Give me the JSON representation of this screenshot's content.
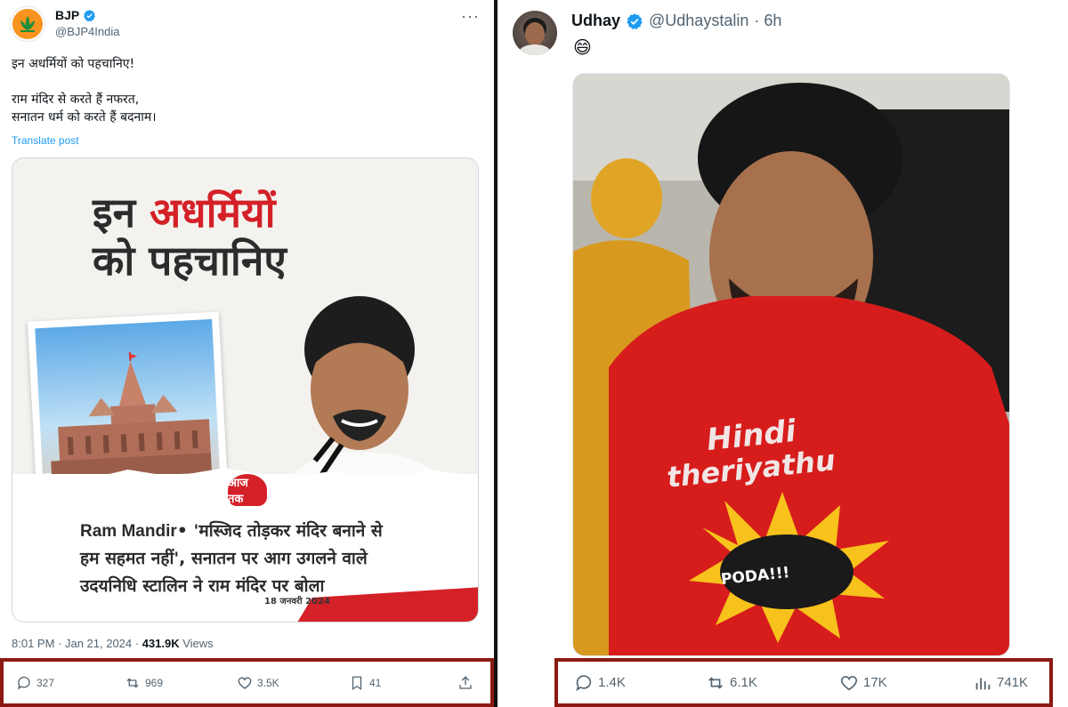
{
  "left_tweet": {
    "name": "BJP",
    "handle": "@BJP4India",
    "text_lines": [
      "इन अधर्मियों को पहचानिए!",
      "",
      "राम मंदिर से करते हैं नफरत,",
      "सनातन धर्म को करते हैं बदनाम।"
    ],
    "translate_label": "Translate post",
    "image": {
      "title_line1_a": "इन ",
      "title_line1_b": "अधर्मियों",
      "title_line2": "को पहचानिए",
      "logo_text": "आज तक",
      "headline_line1_en": "Ram Mandir",
      "headline_line1_sep": "• ",
      "headline_line1_hi": "'मस्जिद तोड़कर मंदिर बनाने से",
      "headline_line2": "हम सहमत नहीं', सनातन पर आग उगलने वाले",
      "headline_line3": "उदयनिधि स्टालिन ने राम मंदिर पर बोला",
      "date": "18 जनवरी 2024"
    },
    "time": "8:01 PM · Jan 21, 2024 · ",
    "views_count": "431.9K",
    "views_label": " Views",
    "actions": {
      "replies": "327",
      "reposts": "969",
      "likes": "3.5K",
      "bookmarks": "41"
    }
  },
  "right_tweet": {
    "name": "Udhay",
    "handle": "@Udhaystalin",
    "age": "· 6h",
    "text": "😄",
    "image": {
      "shirt_line1": "Hindi",
      "shirt_line2": "theriyathu",
      "burst": "PODA!!!"
    },
    "actions": {
      "replies": "1.4K",
      "reposts": "6.1K",
      "likes": "17K",
      "views": "741K"
    }
  },
  "colors": {
    "verified": "#1d9bf0",
    "highlight_border": "#8b1a12",
    "accent_red": "#d42027",
    "bjp_orange": "#f7931e"
  }
}
